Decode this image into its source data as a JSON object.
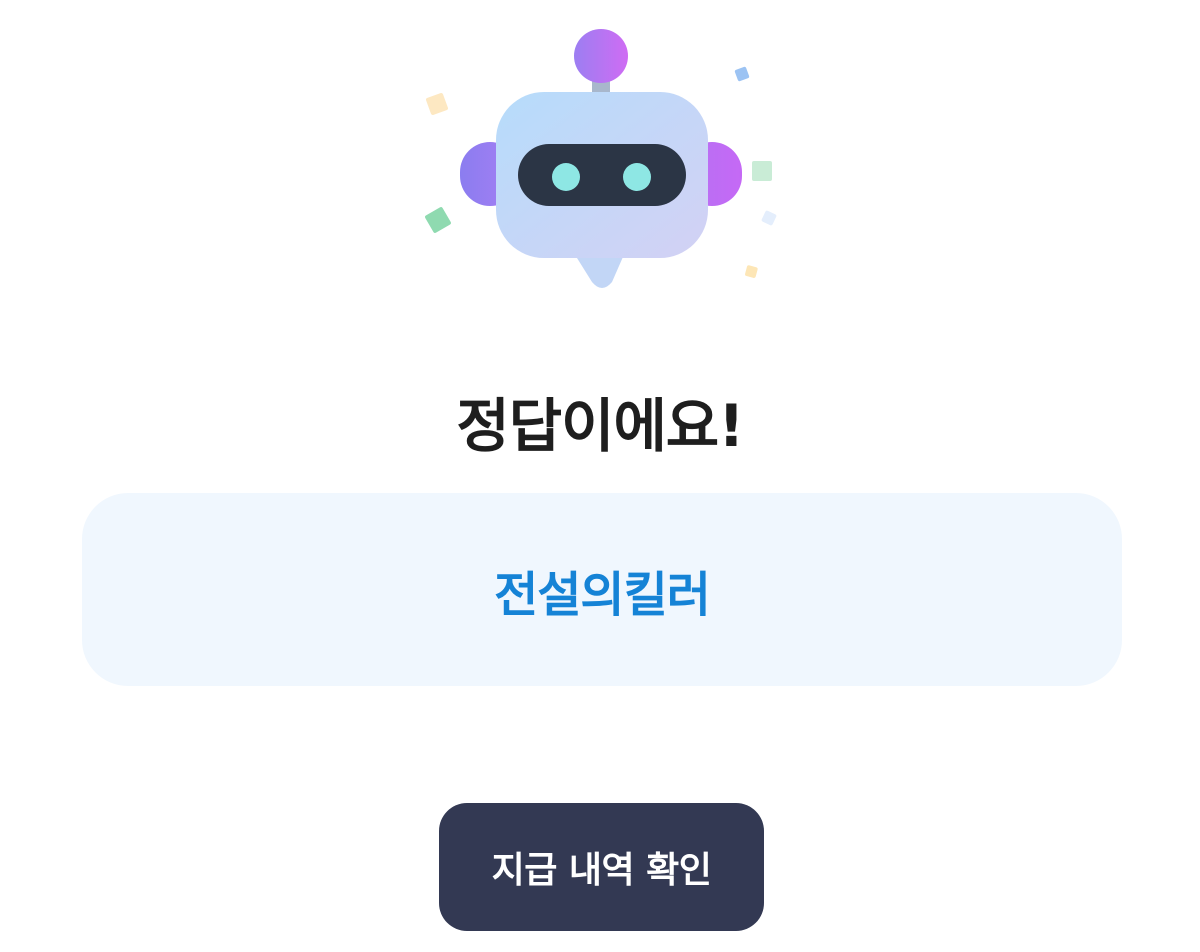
{
  "result": {
    "title": "정답이에요!",
    "answer": "전설의킬러"
  },
  "actions": {
    "confirm_label": "지급 내역 확인"
  },
  "colors": {
    "title": "#1e1e1e",
    "answer_text": "#1583d6",
    "answer_box_bg": "#f0f7fe",
    "button_bg": "#333953",
    "button_text": "#ffffff"
  },
  "icons": {
    "mascot": "robot-mascot-icon"
  }
}
